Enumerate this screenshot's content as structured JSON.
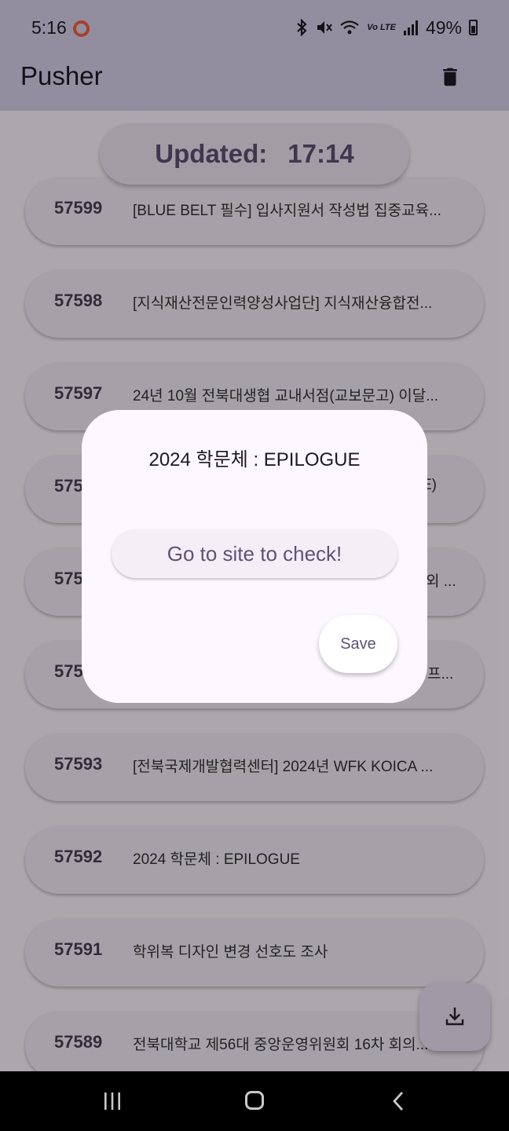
{
  "status_bar": {
    "time": "5:16",
    "battery_percent": "49%",
    "icons": [
      "bluetooth-icon",
      "mute-icon",
      "wifi-icon",
      "volte-icon",
      "signal-icon",
      "battery-icon"
    ],
    "volte_label": "Vo LTE"
  },
  "app_bar": {
    "title": "Pusher",
    "action_icon": "trash-icon"
  },
  "updated": {
    "label": "Updated:",
    "time": "17:14"
  },
  "list": [
    {
      "no": "57599",
      "title": "[BLUE BELT 필수] 입사지원서 작성법 집중교육..."
    },
    {
      "no": "57598",
      "title": "[지식재산전문인력양성사업단] 지식재산융합전..."
    },
    {
      "no": "57597",
      "title": "24년 10월 전북대생협 교내서점(교보문고) 이달..."
    },
    {
      "no": "575",
      "title": "E)"
    },
    {
      "no": "575",
      "title": "외 ..."
    },
    {
      "no": "575",
      "title": "프..."
    },
    {
      "no": "57593",
      "title": "[전북국제개발협력센터] 2024년 WFK KOICA ..."
    },
    {
      "no": "57592",
      "title": "2024 학문체 : EPILOGUE"
    },
    {
      "no": "57591",
      "title": "학위복 디자인 변경 선호도 조사"
    },
    {
      "no": "57589",
      "title": "전북대학교 제56대 중앙운영위원회 16차 회의..."
    }
  ],
  "dialog": {
    "title": "2024 학문체 : EPILOGUE",
    "link_button": "Go to site to check!",
    "save_button": "Save"
  },
  "fab": {
    "icon": "download-icon"
  },
  "colors": {
    "primary": "#5e5276",
    "app_bar": "#d9d2ea",
    "surface": "#fef7ff",
    "record_indicator": "#f3623d"
  }
}
